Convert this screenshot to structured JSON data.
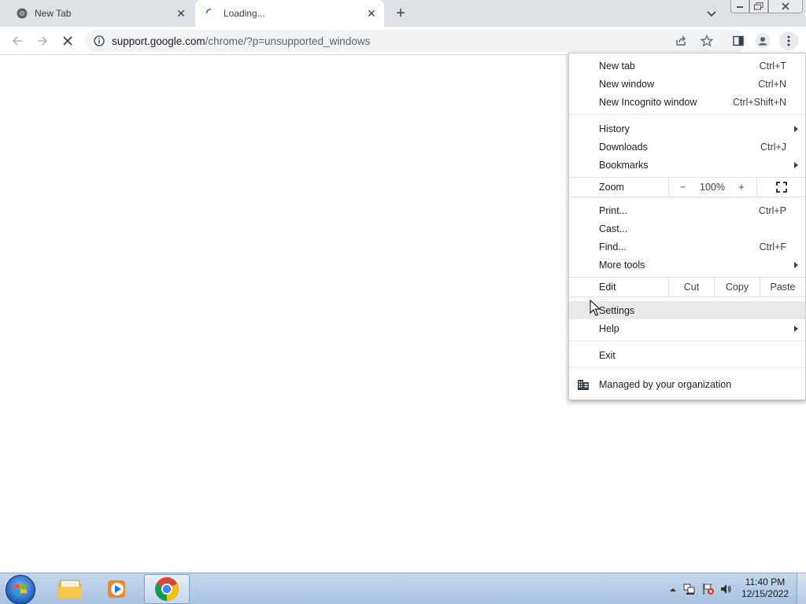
{
  "tabs": [
    {
      "title": "New Tab",
      "favicon": "chrome-icon"
    },
    {
      "title": "Loading...",
      "favicon": "loading-spinner-icon"
    }
  ],
  "omnibox": {
    "url_host": "support.google.com",
    "url_path": "/chrome/?p=unsupported_windows"
  },
  "menu": {
    "items": [
      {
        "label": "New tab",
        "shortcut": "Ctrl+T"
      },
      {
        "label": "New window",
        "shortcut": "Ctrl+N"
      },
      {
        "label": "New Incognito window",
        "shortcut": "Ctrl+Shift+N"
      },
      {
        "label": "History",
        "shortcut": ""
      },
      {
        "label": "Downloads",
        "shortcut": "Ctrl+J"
      },
      {
        "label": "Bookmarks",
        "shortcut": ""
      },
      {
        "label": "Print...",
        "shortcut": "Ctrl+P"
      },
      {
        "label": "Cast...",
        "shortcut": ""
      },
      {
        "label": "Find...",
        "shortcut": "Ctrl+F"
      },
      {
        "label": "More tools",
        "shortcut": ""
      },
      {
        "label": "Settings",
        "shortcut": ""
      },
      {
        "label": "Help",
        "shortcut": ""
      },
      {
        "label": "Exit",
        "shortcut": ""
      }
    ],
    "zoom": {
      "label": "Zoom",
      "minus": "−",
      "value": "100%",
      "plus": "+"
    },
    "edit": {
      "label": "Edit",
      "cut": "Cut",
      "copy": "Copy",
      "paste": "Paste"
    },
    "managed": "Managed by your organization",
    "highlighted": "Settings"
  },
  "taskbar": {
    "time": "11:40 PM",
    "date": "12/15/2022"
  },
  "colors": {
    "tabstrip": "#dee1e6",
    "omnibox": "#f1f3f4",
    "menu_highlight": "#e8e8e8"
  }
}
